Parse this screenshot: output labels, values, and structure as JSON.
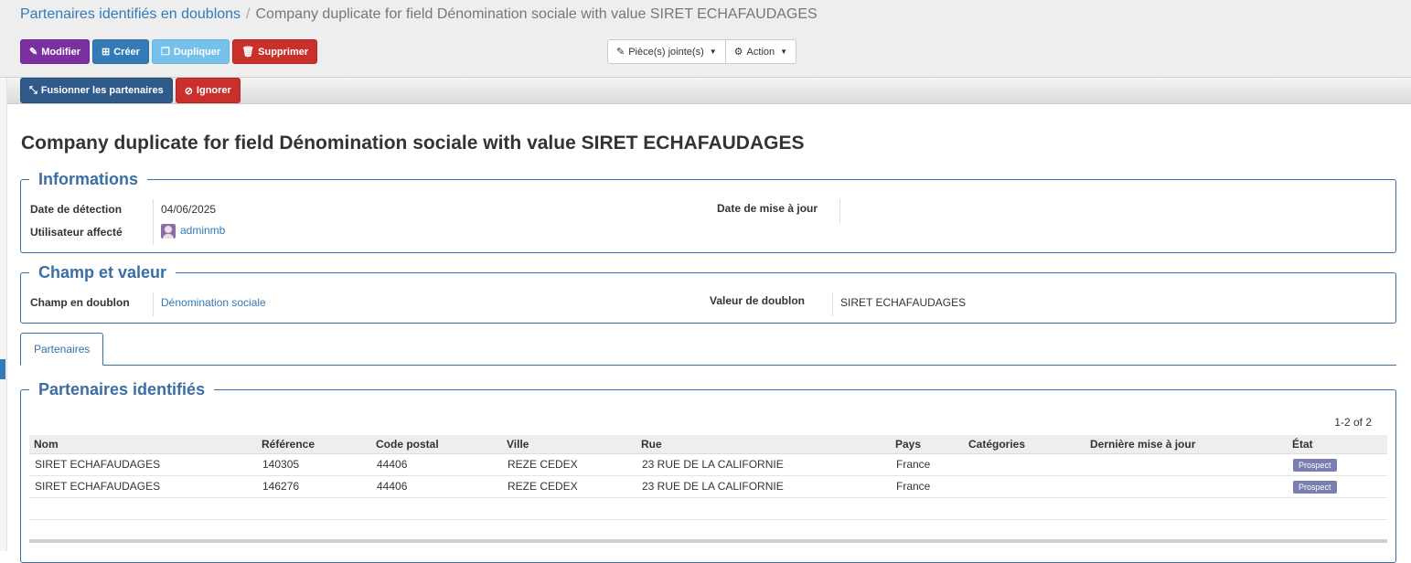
{
  "breadcrumb": {
    "parent": "Partenaires identifiés en doublons",
    "separator": "/",
    "current": "Company duplicate for field Dénomination sociale with value SIRET ECHAFAUDAGES"
  },
  "toolbar": {
    "edit_label": "Modifier",
    "create_label": "Créer",
    "duplicate_label": "Dupliquer",
    "delete_label": "Supprimer",
    "attachments_label": "Pièce(s) jointe(s)",
    "action_label": "Action"
  },
  "statusbar": {
    "merge_label": "Fusionner les partenaires",
    "ignore_label": "Ignorer"
  },
  "record": {
    "title": "Company duplicate for field Dénomination sociale with value SIRET ECHAFAUDAGES"
  },
  "informations": {
    "legend": "Informations",
    "detection_date_label": "Date de détection",
    "detection_date_value": "04/06/2025",
    "assigned_user_label": "Utilisateur affecté",
    "assigned_user_value": "adminmb",
    "update_date_label": "Date de mise à jour",
    "update_date_value": ""
  },
  "champ_valeur": {
    "legend": "Champ et valeur",
    "field_label": "Champ en doublon",
    "field_value": "Dénomination sociale",
    "duplicate_value_label": "Valeur de doublon",
    "duplicate_value": "SIRET ECHAFAUDAGES"
  },
  "tabs": [
    {
      "label": "Partenaires"
    }
  ],
  "partners": {
    "legend": "Partenaires identifiés",
    "pager": "1-2 of 2",
    "columns": [
      "Nom",
      "Référence",
      "Code postal",
      "Ville",
      "Rue",
      "Pays",
      "Catégories",
      "Dernière mise à jour",
      "État"
    ],
    "rows": [
      {
        "nom": "SIRET ECHAFAUDAGES",
        "reference": "140305",
        "code_postal": "44406",
        "ville": "REZE CEDEX",
        "rue": "23 RUE DE LA CALIFORNIE",
        "pays": "France",
        "categories": "",
        "derniere_maj": "",
        "etat": "Prospect"
      },
      {
        "nom": "SIRET ECHAFAUDAGES",
        "reference": "146276",
        "code_postal": "44406",
        "ville": "REZE CEDEX",
        "rue": "23 RUE DE LA CALIFORNIE",
        "pays": "France",
        "categories": "",
        "derniere_maj": "",
        "etat": "Prospect"
      }
    ]
  },
  "icons": {
    "edit": "edit-icon",
    "create": "plus-square-icon",
    "duplicate": "copy-icon",
    "delete": "trash-icon",
    "attachment": "paperclip-icon",
    "action": "gear-icon",
    "merge": "compress-icon",
    "ignore": "ban-icon"
  },
  "colors": {
    "primary": "#337ab7",
    "purple": "#7b30a0",
    "danger": "#c9302c",
    "navy": "#2f5a8a",
    "group_border": "#3a6ea5",
    "badge": "#7a7fb0"
  }
}
